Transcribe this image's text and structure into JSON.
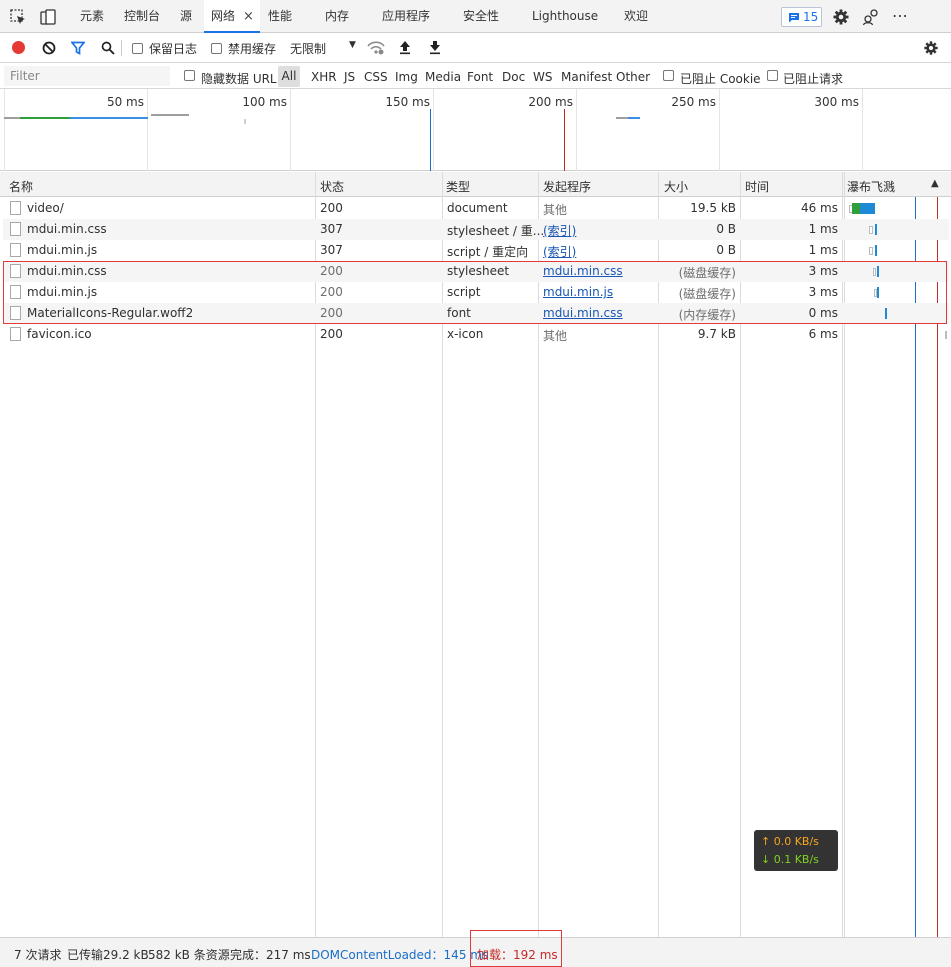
{
  "tabs": [
    {
      "label": "元素"
    },
    {
      "label": "控制台"
    },
    {
      "label": "源"
    },
    {
      "label": "网络",
      "active": true
    },
    {
      "label": "性能"
    },
    {
      "label": "内存"
    },
    {
      "label": "应用程序"
    },
    {
      "label": "安全性"
    },
    {
      "label": "Lighthouse"
    },
    {
      "label": "欢迎"
    }
  ],
  "tab_close": "×",
  "badge_count": "15",
  "toolbar": {
    "preserve_log": "保留日志",
    "disable_cache": "禁用缓存",
    "throttle": "无限制"
  },
  "filter": {
    "placeholder": "Filter",
    "hide_data_url": "隐藏数据 URL",
    "types": [
      "All",
      "XHR",
      "JS",
      "CSS",
      "Img",
      "Media",
      "Font",
      "Doc",
      "WS",
      "Manifest",
      "Other"
    ],
    "blocked_cookies": "已阻止 Cookie",
    "blocked_requests": "已阻止请求"
  },
  "overview_ticks": [
    "50 ms",
    "100 ms",
    "150 ms",
    "200 ms",
    "250 ms",
    "300 ms"
  ],
  "columns": {
    "name": "名称",
    "status": "状态",
    "type": "类型",
    "initiator": "发起程序",
    "size": "大小",
    "time": "时间",
    "waterfall": "瀑布飞溅"
  },
  "rows": [
    {
      "name": "video/",
      "status": "200",
      "type": "document",
      "initiator": "其他",
      "size": "19.5 kB",
      "time": "46 ms"
    },
    {
      "name": "mdui.min.css",
      "status": "307",
      "type": "stylesheet / 重...",
      "initiator": "(索引)",
      "size": "0 B",
      "time": "1 ms"
    },
    {
      "name": "mdui.min.js",
      "status": "307",
      "type": "script / 重定向",
      "initiator": "(索引)",
      "size": "0 B",
      "time": "1 ms"
    },
    {
      "name": "mdui.min.css",
      "status": "200",
      "type": "stylesheet",
      "initiator": "mdui.min.css",
      "size": "(磁盘缓存)",
      "time": "3 ms"
    },
    {
      "name": "mdui.min.js",
      "status": "200",
      "type": "script",
      "initiator": "mdui.min.js",
      "size": "(磁盘缓存)",
      "time": "3 ms"
    },
    {
      "name": "MaterialIcons-Regular.woff2",
      "status": "200",
      "type": "font",
      "initiator": "mdui.min.css",
      "size": "(内存缓存)",
      "time": "0 ms"
    },
    {
      "name": "favicon.ico",
      "status": "200",
      "type": "x-icon",
      "initiator": "其他",
      "size": "9.7 kB",
      "time": "6 ms"
    }
  ],
  "speed": {
    "up": "↑ 0.0 KB/s",
    "down": "↓ 0.1 KB/s"
  },
  "status": {
    "requests": "7 次请求",
    "transferred": "已传输29.2 kB",
    "resources": "582 kB 条资源",
    "finish": "完成：217 ms",
    "dcl": "DOMContentLoaded：145 ms",
    "load": "加载：192 ms"
  },
  "colors": {
    "accent": "#1a73e8",
    "record": "#e53935",
    "highlight": "#e03a3a",
    "dcl_line": "#1a6ec7",
    "load_line": "#c62828"
  }
}
